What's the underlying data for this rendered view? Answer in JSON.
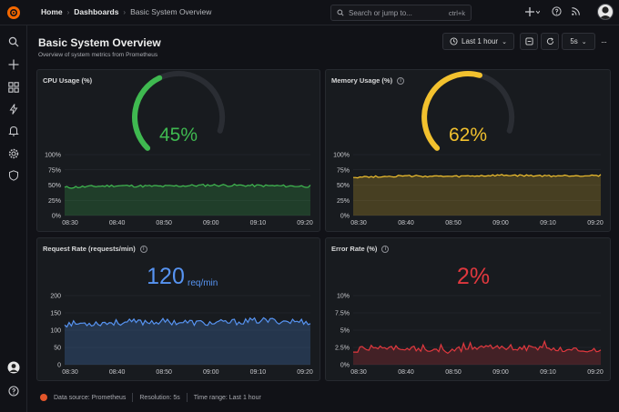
{
  "breadcrumb": {
    "home": "Home",
    "dashboards": "Dashboards",
    "current": "Basic System Overview"
  },
  "search": {
    "placeholder": "Search or jump to...",
    "shortcut": "ctrl+k"
  },
  "top_icons": [
    "plus-icon",
    "help-icon",
    "rss-icon"
  ],
  "rail_icons": [
    "search-icon",
    "plus-icon",
    "dashboards-icon",
    "alerting-icon",
    "bell-icon",
    "gear-icon",
    "shield-icon"
  ],
  "page": {
    "title": "Basic System Overview",
    "subtitle": "Overview of system metrics from Prometheus"
  },
  "toolbar": {
    "time_range": "Last 1 hour",
    "refresh_interval": "5s"
  },
  "colors": {
    "green": "#3fb950",
    "yellow": "#f2c12e",
    "blue": "#5794f2",
    "red": "#e0383e",
    "bg": "#111217",
    "panel": "#181b1f"
  },
  "x_ticks": [
    "08:30",
    "08:40",
    "08:50",
    "09:00",
    "09:10",
    "09:20"
  ],
  "panels": {
    "cpu": {
      "title": "CPU Usage (%)",
      "value": "45%",
      "gauge_fraction": 0.45,
      "y_ticks": [
        "100%",
        "75%",
        "50%",
        "25%",
        "0%"
      ]
    },
    "memory": {
      "title": "Memory Usage (%)",
      "value": "62%",
      "gauge_fraction": 0.62,
      "y_ticks": [
        "100%",
        "75%",
        "50%",
        "25%",
        "0%"
      ]
    },
    "requests": {
      "title": "Request Rate (requests/min)",
      "value": "120",
      "unit": "req/min",
      "y_ticks": [
        "200",
        "150",
        "100",
        "50",
        "0"
      ]
    },
    "errors": {
      "title": "Error Rate (%)",
      "value": "2%",
      "y_ticks": [
        "10%",
        "7.5%",
        "5%",
        "2.5%",
        "0%"
      ]
    }
  },
  "chart_data": [
    {
      "type": "area",
      "title": "CPU Usage (%)",
      "x": [
        "08:30",
        "08:40",
        "08:50",
        "09:00",
        "09:10",
        "09:20"
      ],
      "ylim": [
        0,
        100
      ],
      "series": [
        {
          "values": [
            46,
            49,
            48,
            50,
            49,
            48
          ]
        }
      ]
    },
    {
      "type": "area",
      "title": "Memory Usage (%)",
      "x": [
        "08:30",
        "08:40",
        "08:50",
        "09:00",
        "09:10",
        "09:20"
      ],
      "ylim": [
        0,
        100
      ],
      "series": [
        {
          "values": [
            63,
            65,
            64,
            66,
            65,
            66
          ]
        }
      ]
    },
    {
      "type": "area",
      "title": "Request Rate (requests/min)",
      "x": [
        "08:30",
        "08:40",
        "08:50",
        "09:00",
        "09:10",
        "09:20"
      ],
      "ylim": [
        0,
        200
      ],
      "series": [
        {
          "values": [
            118,
            122,
            125,
            120,
            128,
            124
          ]
        }
      ]
    },
    {
      "type": "area",
      "title": "Error Rate (%)",
      "x": [
        "08:30",
        "08:40",
        "08:50",
        "09:00",
        "09:10",
        "09:20"
      ],
      "ylim": [
        0,
        10
      ],
      "series": [
        {
          "values": [
            2.2,
            2.4,
            2.0,
            2.6,
            2.3,
            2.1
          ]
        }
      ]
    }
  ],
  "footer": {
    "datasource": "Data source: Prometheus",
    "resolution": "Resolution: 5s",
    "time_range": "Time range: Last 1 hour"
  }
}
